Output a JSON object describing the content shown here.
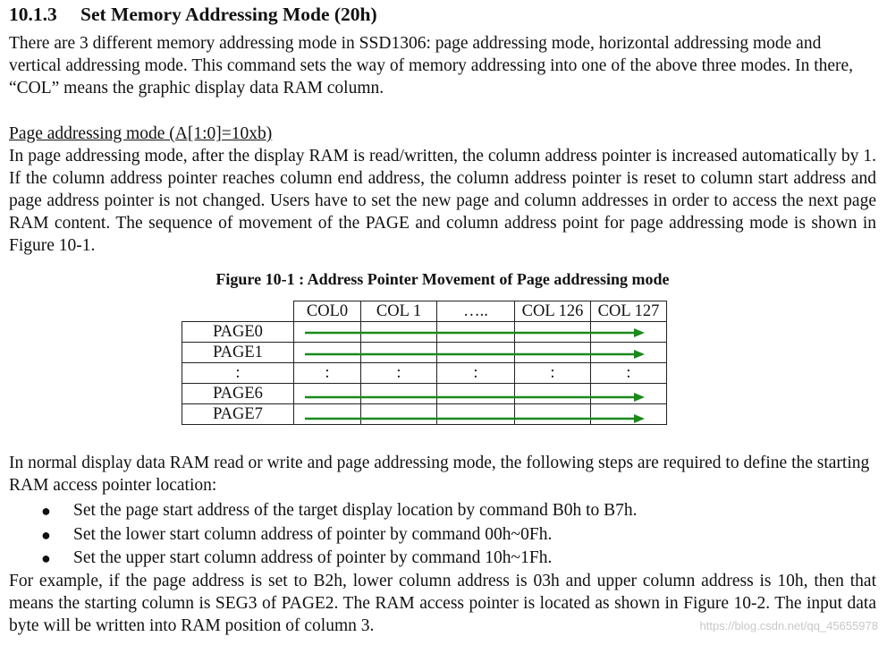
{
  "heading": {
    "number": "10.1.3",
    "title": "Set Memory Addressing Mode (20h)"
  },
  "intro": "There are 3 different memory addressing mode in SSD1306: page addressing mode, horizontal addressing mode and vertical addressing mode. This command sets the way of memory addressing into one of the above three modes. In there, “COL” means the graphic display data RAM column.",
  "page_mode": {
    "subheading": "Page addressing mode (A[1:0]=10xb)",
    "text": "In page addressing mode, after the display RAM is read/written, the column address pointer is increased automatically by 1.  If the column address pointer reaches column end address, the column address pointer is reset to column start address and page address pointer is not changed. Users have to set the new page and column addresses in order to access the next page RAM content. The sequence of movement of the PAGE and column address point for page addressing mode is shown in Figure 10-1."
  },
  "figure": {
    "caption": "Figure 10-1 : Address Pointer Movement of Page addressing mode",
    "columns": [
      "COL0",
      "COL 1",
      "…..",
      "COL 126",
      "COL 127"
    ],
    "rows": [
      {
        "label": "PAGE0",
        "arrow": true
      },
      {
        "label": "PAGE1",
        "arrow": true
      },
      {
        "label": ":",
        "arrow": false,
        "dots": [
          ":",
          ":",
          ":",
          ":",
          ":"
        ]
      },
      {
        "label": "PAGE6",
        "arrow": true
      },
      {
        "label": "PAGE7",
        "arrow": true
      }
    ],
    "arrow_color": "#1a8a1a"
  },
  "normal_mode": "In normal display data RAM read or write and page addressing mode, the following steps are required to define the starting RAM access pointer location:",
  "steps": [
    "Set the page start address of the target display location by command B0h to B7h.",
    "Set the lower start column address of pointer by command 00h~0Fh.",
    "Set the upper start column address of pointer by command 10h~1Fh."
  ],
  "bullet_glyph": "●",
  "example": "For example, if the page address is set to B2h, lower column address is 03h and upper column address is 10h, then that means the starting column is SEG3 of PAGE2. The RAM access pointer is located as shown in Figure 10-2.  The input data byte will be written into RAM position of column 3.",
  "watermark": "https://blog.csdn.net/qq_45655978"
}
